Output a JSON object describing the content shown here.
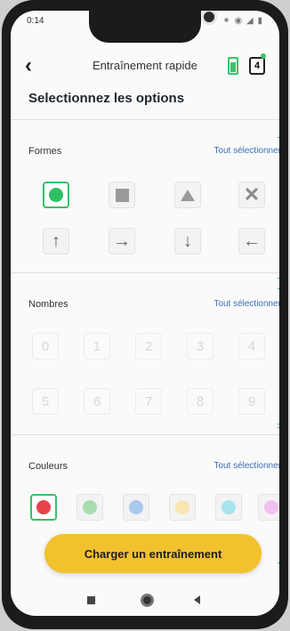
{
  "status_bar": {
    "time": "0:14",
    "right_icons": "⁕ ◉ ◢ ▮"
  },
  "header": {
    "back": "‹",
    "title": "Entraînement rapide",
    "counter": "4"
  },
  "subtitle": "Selectionnez les options",
  "sections": {
    "formes": {
      "label": "Formes",
      "select_all": "Tout sélectionner"
    },
    "nombres": {
      "label": "Nombres",
      "select_all": "Tout sélectionner",
      "numbers": [
        "0",
        "1",
        "2",
        "3",
        "4",
        "5",
        "6",
        "7",
        "8",
        "9"
      ]
    },
    "couleurs": {
      "label": "Couleurs",
      "select_all": "Tout sélectionner",
      "colors": [
        "#e8424a",
        "#a8dcb0",
        "#a9c9ef",
        "#f7e6b2",
        "#a8e4ec",
        "#f3bff0"
      ]
    }
  },
  "shapes_row1": [
    "circle-icon",
    "square-icon",
    "triangle-icon",
    "x-icon"
  ],
  "arrows": [
    "↑",
    "→",
    "↓",
    "←"
  ],
  "cta": "Charger un entraînement"
}
